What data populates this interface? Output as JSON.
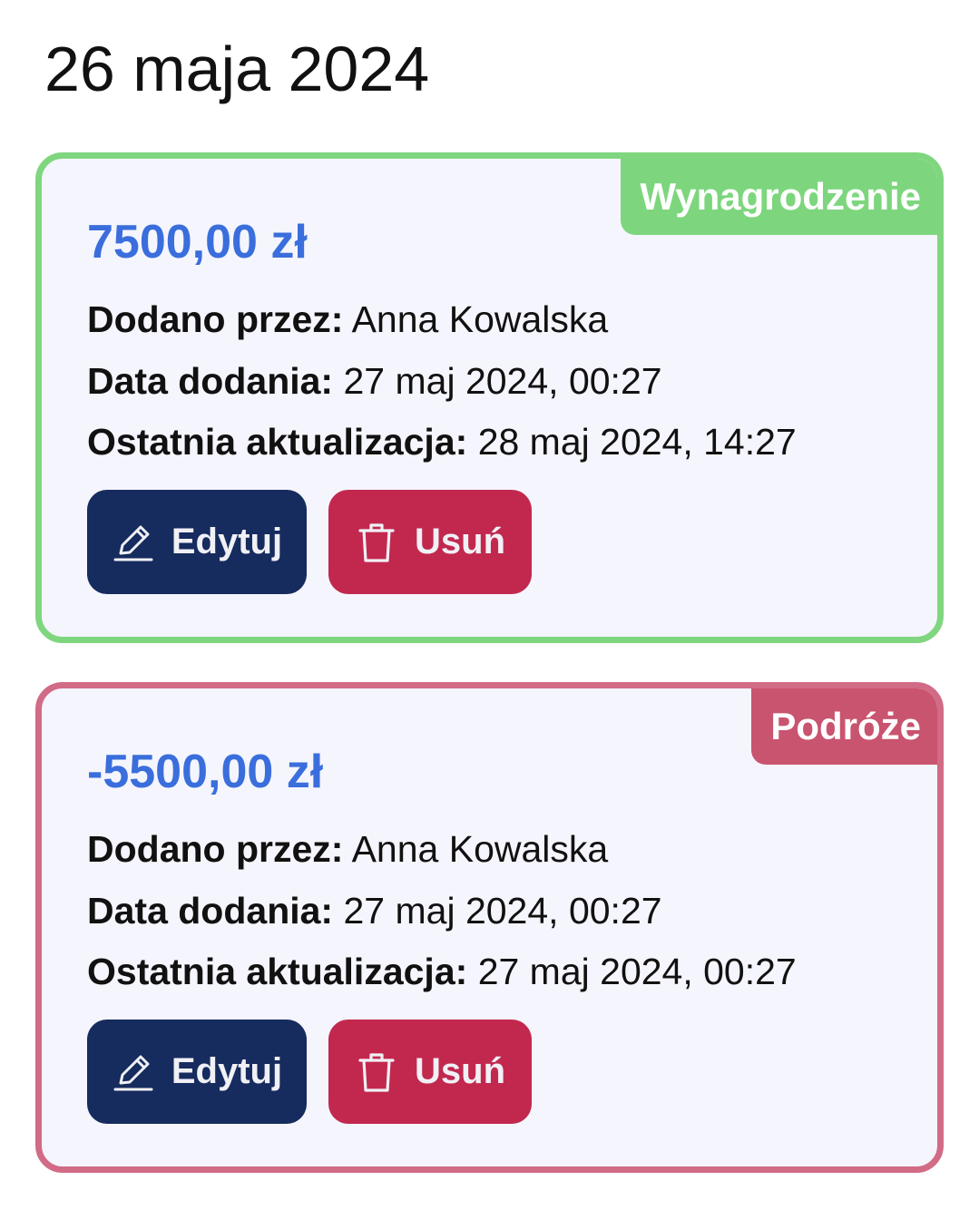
{
  "date_heading": "26 maja 2024",
  "transactions": [
    {
      "category": "Wynagrodzenie",
      "type": "income",
      "border_color": "#7fd67f",
      "badge_color": "#7dd67d",
      "amount": "7500,00 zł",
      "added_by_label": "Dodano przez:",
      "added_by": "Anna Kowalska",
      "date_added_label": "Data dodania:",
      "date_added": "27 maj 2024, 00:27",
      "last_update_label": "Ostatnia aktualizacja:",
      "last_update": "28 maj 2024, 14:27",
      "edit_label": "Edytuj",
      "delete_label": "Usuń",
      "edit_icon": "pencil-icon",
      "delete_icon": "trash-icon"
    },
    {
      "category": "Podróże",
      "type": "expense",
      "border_color": "#d16b86",
      "badge_color": "#c9546f",
      "amount": "-5500,00 zł",
      "added_by_label": "Dodano przez:",
      "added_by": "Anna Kowalska",
      "date_added_label": "Data dodania:",
      "date_added": "27 maj 2024, 00:27",
      "last_update_label": "Ostatnia aktualizacja:",
      "last_update": "27 maj 2024, 00:27",
      "edit_label": "Edytuj",
      "delete_label": "Usuń",
      "edit_icon": "pencil-icon",
      "delete_icon": "trash-icon"
    }
  ],
  "colors": {
    "amount": "#3a6edc",
    "edit_button": "#162b5e",
    "delete_button": "#c2284e",
    "card_background": "#f5f5fd"
  }
}
